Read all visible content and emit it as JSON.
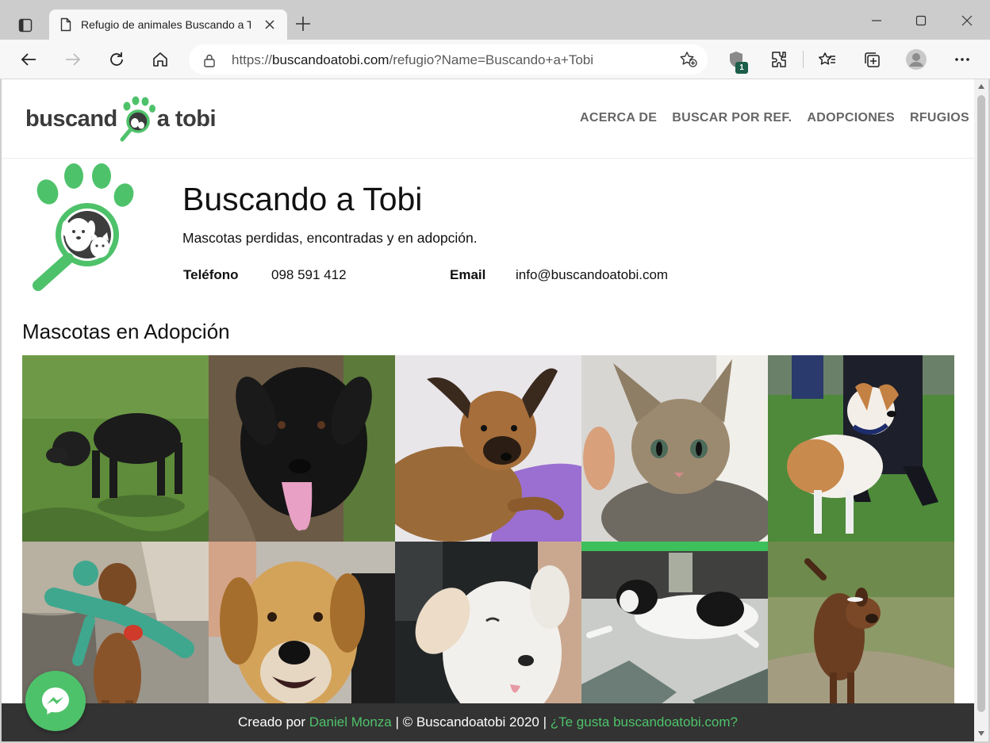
{
  "browser": {
    "tab_title": "Refugio de animales Buscando a Tobi",
    "url_scheme": "https://",
    "url_host": "buscandoatobi.com",
    "url_path": "/refugio?Name=Buscando+a+Tobi",
    "extension_badge": "1"
  },
  "site": {
    "logo_part1": "buscand",
    "logo_part2": "a tobi",
    "nav": [
      "ACERCA DE",
      "BUSCAR POR REF.",
      "ADOPCIONES",
      "RFUGIOS"
    ],
    "brand_color": "#4ec26a"
  },
  "shelter": {
    "name": "Buscando a Tobi",
    "description": "Mascotas perdidas, encontradas y en adopción.",
    "phone_label": "Teléfono",
    "phone": "098 591 412",
    "email_label": "Email",
    "email": "info@buscandoatobi.com"
  },
  "adoption": {
    "title": "Mascotas en Adopción",
    "pets": [
      {
        "kind": "black-dog-on-grass"
      },
      {
        "kind": "black-dog-tongue"
      },
      {
        "kind": "brown-puppy-lying"
      },
      {
        "kind": "tabby-kitten"
      },
      {
        "kind": "white-brown-dog-collar"
      },
      {
        "kind": "puppy-with-green-toy"
      },
      {
        "kind": "golden-dog-face"
      },
      {
        "kind": "white-puppy"
      },
      {
        "kind": "black-white-dog-floor"
      },
      {
        "kind": "brown-dog-on-grass"
      }
    ]
  },
  "footer": {
    "prefix": "Creado por ",
    "author": "Daniel Monza",
    "middle": " | © Buscandoatobi 2020 | ",
    "link": "¿Te gusta buscandoatobi.com?"
  }
}
